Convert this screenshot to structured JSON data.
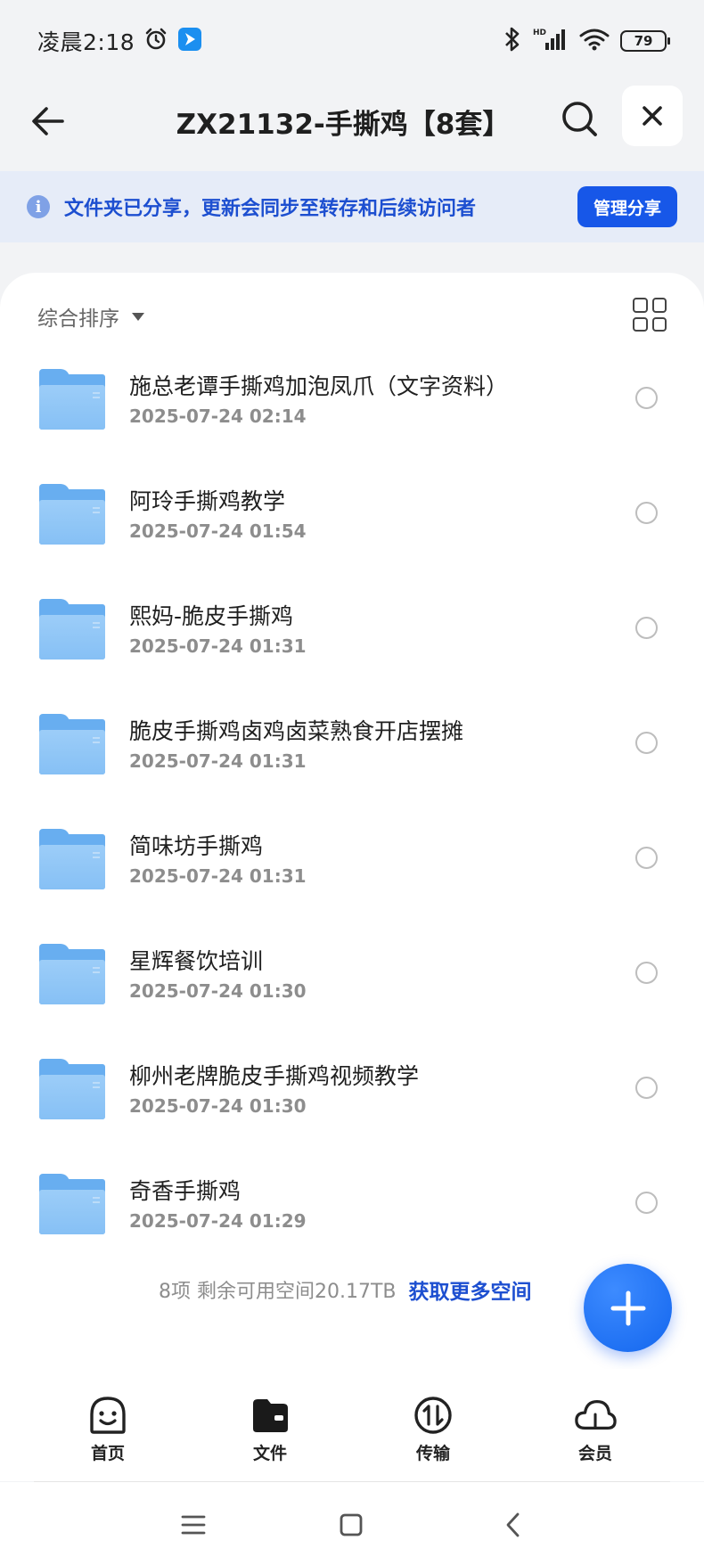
{
  "status_bar": {
    "time": "凌晨2:18",
    "battery": "79",
    "icons": [
      "alarm-icon",
      "app-notification-icon",
      "bluetooth-icon",
      "hd-signal-icon",
      "wifi-icon",
      "battery-icon"
    ]
  },
  "header": {
    "title": "ZX21132-手撕鸡【8套】"
  },
  "share_banner": {
    "text": "文件夹已分享，更新会同步至转存和后续访问者",
    "button_label": "管理分享"
  },
  "sort": {
    "label": "综合排序"
  },
  "files": [
    {
      "name": "施总老谭手撕鸡加泡凤爪（文字资料）",
      "date": "2025-07-24 02:14"
    },
    {
      "name": "阿玲手撕鸡教学",
      "date": "2025-07-24 01:54"
    },
    {
      "name": "熙妈-脆皮手撕鸡",
      "date": "2025-07-24 01:31"
    },
    {
      "name": "脆皮手撕鸡卤鸡卤菜熟食开店摆摊",
      "date": "2025-07-24 01:31"
    },
    {
      "name": "简味坊手撕鸡",
      "date": "2025-07-24 01:31"
    },
    {
      "name": "星辉餐饮培训",
      "date": "2025-07-24 01:30"
    },
    {
      "name": "柳州老牌脆皮手撕鸡视频教学",
      "date": "2025-07-24 01:30"
    },
    {
      "name": "奇香手撕鸡",
      "date": "2025-07-24 01:29"
    }
  ],
  "footer": {
    "count_text": "8项 剩余可用空间20.17TB",
    "link_text": "获取更多空间"
  },
  "bottom_nav": {
    "items": [
      {
        "label": "首页",
        "icon": "home-icon"
      },
      {
        "label": "文件",
        "icon": "files-icon"
      },
      {
        "label": "传输",
        "icon": "transfer-icon"
      },
      {
        "label": "会员",
        "icon": "cloud-icon"
      }
    ]
  },
  "colors": {
    "accent": "#1757e8",
    "banner_bg": "#e6ecf8",
    "banner_text": "#1d4fd0",
    "folder": "#68aef0"
  }
}
